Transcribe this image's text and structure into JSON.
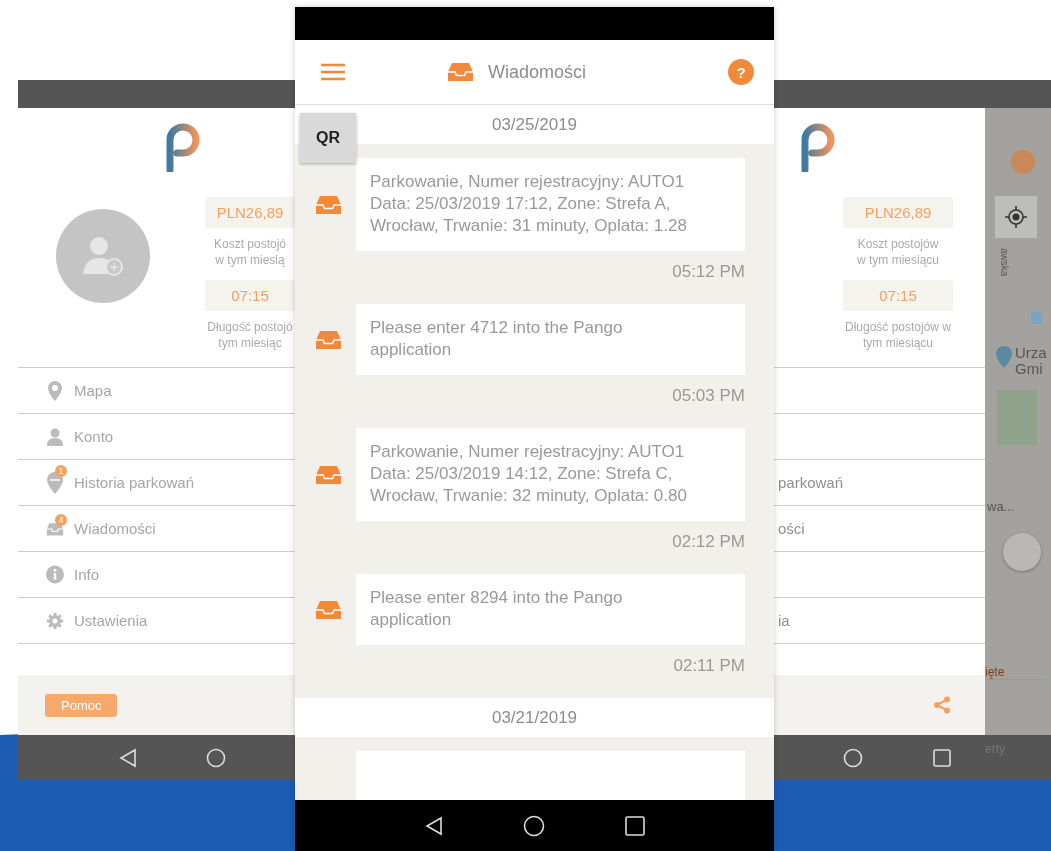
{
  "left_phone": {
    "stats": [
      {
        "value": "PLN26,89",
        "label_lines": [
          "Koszt postojó",
          "w tym miesią"
        ]
      },
      {
        "value": "07:15",
        "label_lines": [
          "Długość postojó",
          "tym miesiąc"
        ]
      }
    ],
    "menu": [
      {
        "kind": "pin",
        "label": "Mapa"
      },
      {
        "kind": "person",
        "label": "Konto"
      },
      {
        "kind": "history",
        "label": "Historia parkowań",
        "badge": "1"
      },
      {
        "kind": "inbox",
        "label": "Wiadomości",
        "badge": "4"
      },
      {
        "kind": "info",
        "label": "Info"
      },
      {
        "kind": "gear",
        "label": "Ustawienia"
      }
    ],
    "help_button": "Pomoc"
  },
  "center_phone": {
    "title": "Wiadomości",
    "help_icon": "?",
    "qr_button": "QR",
    "groups": [
      {
        "date": "03/25/2019",
        "messages": [
          {
            "lines": [
              "Parkowanie, Numer rejestracyjny: AUTO1",
              "Data: 25/03/2019 17:12, Zone: Strefa A,",
              "Wrocław, Trwanie: 31 minuty, Oplata: 1.28"
            ],
            "time": "05:12 PM"
          },
          {
            "lines": [
              "Please enter 4712 into the Pango",
              "application"
            ],
            "time": "05:03 PM"
          },
          {
            "lines": [
              "Parkowanie, Numer rejestracyjny: AUTO1",
              "Data: 25/03/2019 14:12, Zone: Strefa C,",
              "Wrocław, Trwanie: 32 minuty, Oplata: 0.80"
            ],
            "time": "02:12 PM"
          },
          {
            "lines": [
              "Please enter 8294 into the Pango",
              "application"
            ],
            "time": "02:11 PM"
          }
        ]
      },
      {
        "date": "03/21/2019"
      }
    ]
  },
  "right_phone": {
    "stats": [
      {
        "value": "PLN26,89",
        "label_lines": [
          "Koszt postojów",
          "w tym miesiącu"
        ]
      },
      {
        "value": "07:15",
        "label_lines": [
          "Długość postojów w",
          "tym miesiącu"
        ]
      }
    ],
    "menu": [
      {
        "kind": "blank"
      },
      {
        "kind": "blank"
      },
      {
        "kind": "text",
        "label": "parkowań"
      },
      {
        "kind": "text",
        "label": "ości"
      },
      {
        "kind": "blank"
      },
      {
        "kind": "text",
        "label": "ia"
      }
    ],
    "map": {
      "street": "awska",
      "place_lines": [
        "Urza",
        "Gmi"
      ],
      "road_label": "wa...",
      "tab_label": "ięte",
      "bottom_label": "erty"
    }
  }
}
